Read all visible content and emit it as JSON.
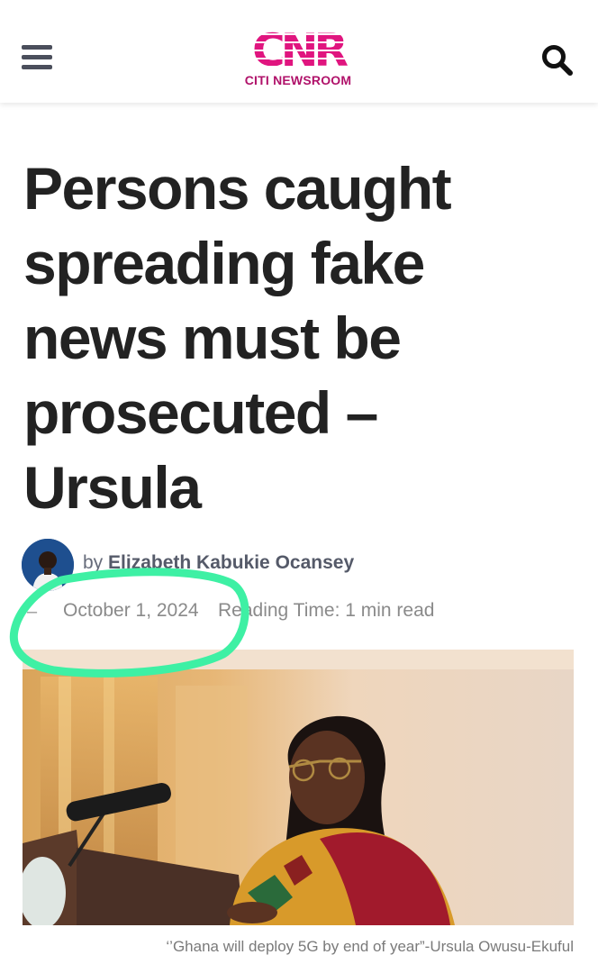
{
  "header": {
    "menu_icon": "hamburger-menu-icon",
    "logo_mark": "CNR",
    "logo_subtitle": "CITI NEWSROOM",
    "search_icon": "search-icon",
    "brand_color": "#e0157f"
  },
  "article": {
    "headline": "Persons caught spreading fake news must be prosecuted – Ursula",
    "byline_prefix": "by",
    "author": "Elizabeth Kabukie Ocansey",
    "date_prefix": "–",
    "date": "October 1, 2024",
    "reading_time": "Reading Time: 1 min read",
    "image_caption": "‘’Ghana will deploy 5G by end of year”-Ursula Owusu-Ekuful"
  },
  "annotation": {
    "highlight_color": "#3ef0a4"
  }
}
